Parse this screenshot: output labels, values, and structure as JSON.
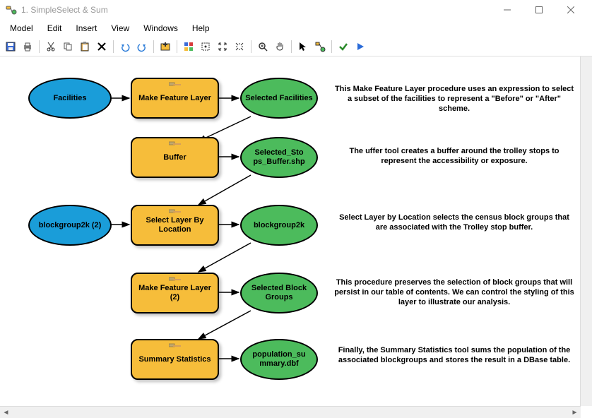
{
  "window": {
    "title": "1. SimpleSelect & Sum"
  },
  "menu": {
    "model": "Model",
    "edit": "Edit",
    "insert": "Insert",
    "view": "View",
    "windows": "Windows",
    "help": "Help"
  },
  "nodes": {
    "facilities": {
      "label": "Facilities"
    },
    "makeFeature1": {
      "label": "Make Feature Layer"
    },
    "selectedFacilities": {
      "label": "Selected Facilities"
    },
    "buffer": {
      "label": "Buffer"
    },
    "selectedStops": {
      "label": "Selected_Sto ps_Buffer.shp"
    },
    "blockgroup2k2": {
      "label": "blockgroup2k (2)"
    },
    "selectLayerLoc": {
      "label": "Select Layer By Location"
    },
    "blockgroup2k": {
      "label": "blockgroup2k"
    },
    "makeFeature2": {
      "label": "Make Feature Layer (2)"
    },
    "selectedBlockGroups": {
      "label": "Selected Block Groups"
    },
    "summaryStats": {
      "label": "Summary Statistics"
    },
    "populationSummary": {
      "label": "population_su mmary.dbf"
    }
  },
  "desc": {
    "d1": "This Make Feature Layer procedure uses an expression to select a  subset of the facilities to represent a \"Before\" or \"After\" scheme.",
    "d2": "The uffer tool creates a  buffer around the trolley stops to represent the accessibility or exposure.",
    "d3": "Select Layer by Location selects the census block groups that are associated with the Trolley stop buffer.",
    "d4": "This procedure preserves the selection of block groups that will persist in our table of contents. We can control the styling of this layer to illustrate our analysis.",
    "d5": "Finally, the Summary Statistics tool sums the population of the associated blockgroups and stores the result in a DBase table."
  }
}
